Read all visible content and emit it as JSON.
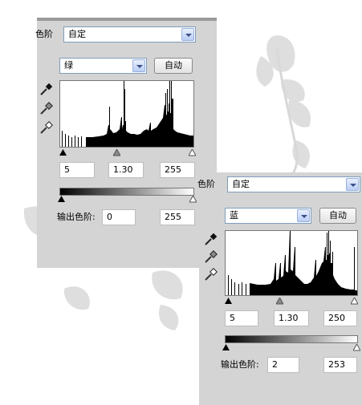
{
  "green_panel": {
    "label": "色阶",
    "preset_value": "自定",
    "channel_value": "绿",
    "auto_label": "自动",
    "input_black": "5",
    "input_gamma": "1.30",
    "input_white": "255",
    "output_label": "输出色阶:",
    "output_black": "0",
    "output_white": "255"
  },
  "blue_panel": {
    "label": "色阶",
    "preset_value": "自定",
    "channel_value": "蓝",
    "auto_label": "自动",
    "input_black": "5",
    "input_gamma": "1.30",
    "input_white": "250",
    "output_label": "输出色阶:",
    "output_black": "2",
    "output_white": "253"
  },
  "icons": [
    "eyedropper-black-icon",
    "eyedropper-gray-icon",
    "eyedropper-white-icon",
    "chevron-down-icon"
  ],
  "colors": {
    "panel_bg": "#d4d4d4",
    "select_border": "#7f9db9",
    "histogram_fill": "#000000"
  }
}
